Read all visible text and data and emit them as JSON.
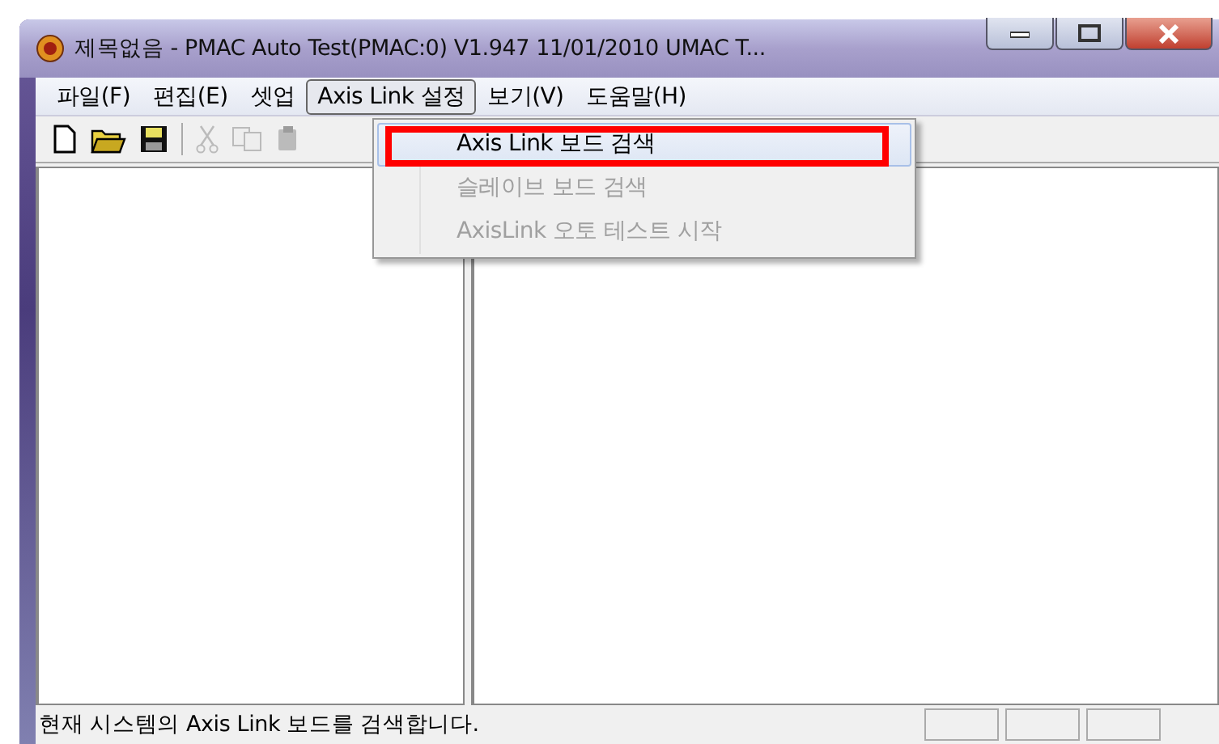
{
  "window": {
    "title": "제목없음 - PMAC Auto Test(PMAC:0) V1.947   11/01/2010 UMAC T..."
  },
  "menu_bar": [
    {
      "label": "파일(F)",
      "selected": false
    },
    {
      "label": "편집(E)",
      "selected": false
    },
    {
      "label": "셋업",
      "selected": false
    },
    {
      "label": "Axis Link 설정",
      "selected": true
    },
    {
      "label": "보기(V)",
      "selected": false
    },
    {
      "label": "도움말(H)",
      "selected": false
    }
  ],
  "toolbar": [
    {
      "kind": "new",
      "disabled": false
    },
    {
      "kind": "open",
      "disabled": false
    },
    {
      "kind": "save",
      "disabled": false
    },
    {
      "kind": "separator"
    },
    {
      "kind": "cut",
      "disabled": true
    },
    {
      "kind": "copy",
      "disabled": true
    },
    {
      "kind": "paste",
      "disabled": true
    }
  ],
  "dropdown": [
    {
      "label": "Axis Link 보드 검색",
      "disabled": false,
      "highlighted": true
    },
    {
      "label": "슬레이브 보드 검색",
      "disabled": true,
      "highlighted": false
    },
    {
      "label": "AxisLink 오토 테스트 시작",
      "disabled": true,
      "highlighted": false
    }
  ],
  "status_bar": {
    "text": "현재 시스템의 Axis Link 보드를 검색합니다."
  }
}
